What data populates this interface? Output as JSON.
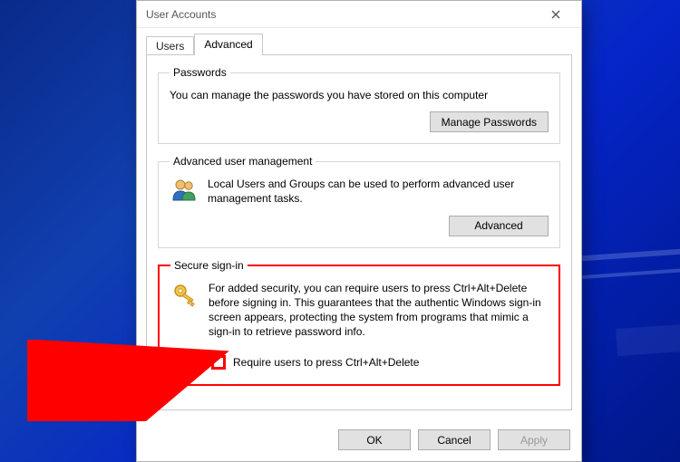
{
  "window": {
    "title": "User Accounts"
  },
  "tabs": {
    "users": "Users",
    "advanced": "Advanced"
  },
  "passwords": {
    "legend": "Passwords",
    "desc": "You can manage the passwords you have stored on this computer",
    "button": "Manage Passwords"
  },
  "advancedMgmt": {
    "legend": "Advanced user management",
    "desc": "Local Users and Groups can be used to perform advanced user management tasks.",
    "button": "Advanced"
  },
  "secure": {
    "legend": "Secure sign-in",
    "desc": "For added security, you can require users to press Ctrl+Alt+Delete before signing in. This guarantees that the authentic Windows sign-in screen appears, protecting the system from programs that mimic a sign-in to retrieve password info.",
    "checkbox": "Require users to press Ctrl+Alt+Delete"
  },
  "footer": {
    "ok": "OK",
    "cancel": "Cancel",
    "apply": "Apply"
  }
}
